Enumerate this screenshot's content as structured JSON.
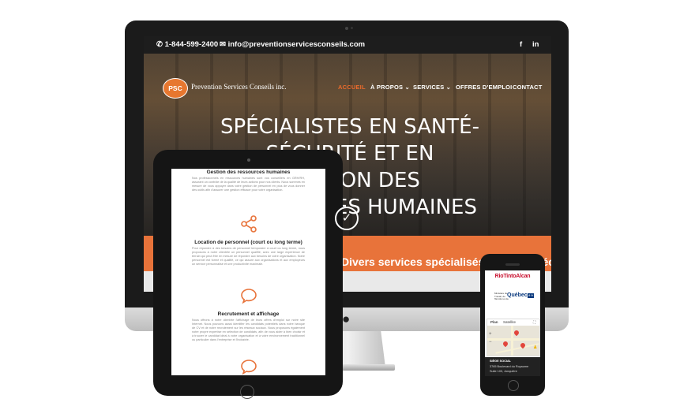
{
  "desktop": {
    "topbar": {
      "phone": "1-844-599-2400",
      "email": "info@preventionservicesconseils.com",
      "social": [
        "f",
        "in"
      ]
    },
    "logo": {
      "badge": "PSC",
      "text": "Prevention Services Conseils inc."
    },
    "nav": [
      {
        "label": "ACCUEIL",
        "active": true
      },
      {
        "label": "À PROPOS ⌄",
        "active": false
      },
      {
        "label": "SERVICES ⌄",
        "active": false
      },
      {
        "label": "OFFRES D'EMPLOI",
        "active": false
      },
      {
        "label": "CONTACT",
        "active": false
      }
    ],
    "hero_title": "SPÉCIALISTES EN SANTÉ-SÉCURITÉ ET EN GESTION DES RESSOURCES HUMAINES",
    "check_glyph": "✓",
    "band_text": "Divers services spécialisés en santé-sécurité",
    "colors": {
      "accent": "#e8733a",
      "topbar": "#1d1d1d"
    }
  },
  "tablet": {
    "sections": [
      {
        "icon": "people-icon",
        "heading": "Gestion des ressources humaines",
        "text": "Nos professionnels en ressources humaines sont vos conseillers en GRH/RH, assurant un contrôle de la qualité de leurs actions pour nos clients. Nous sommes en mesure de vous appuyer dans votre gestion de personnel en plus de vous donner des outils afin d'assurer une gestion efficace pour votre organisation."
      },
      {
        "icon": "share-icon",
        "heading": "Location de personnel (court ou long terme)",
        "text": "Pour répondre à des besoins de personnel temporaire à court ou long terme, nous proposons à notre clientèle un personnel qualifié, avec une large expérience de terrain qui peut être en mesure de répondre aux besoins de votre organisation. Notre personnel est formé et qualifié, ce qui assure aux organisations et aux employeurs un service personnalisé et une productivité maximale."
      },
      {
        "icon": "chat-bubble-icon",
        "heading": "Recrutement et affichage",
        "text": "Nous offrons à notre clientèle l'affichage de leurs offres d'emploi sur notre site Internet. Nous pouvons aussi identifier les candidats potentiels dans notre banque de CV et de notre recrutement sur les réseaux sociaux. Nous proposons également notre propre expertise en sélection de candidats, afin de vous aider à bien choisir et à trouver le candidat idéal à votre organisation et à votre environnement traditionnel ou particulier dans l'entreprise et l'industrie."
      }
    ],
    "partial_icon": "chat-bubble-icon",
    "colors": {
      "icon": "#e8733a"
    }
  },
  "phone": {
    "brand_logo": "RioTintoAlcan",
    "qc_small_text": "Ministère du Travail, de l'Emploi et de la Solidarité sociale",
    "qc_logo": "Québec",
    "qc_flag": "⚜⚜",
    "map_tabs": [
      "Plan",
      "Satellite"
    ],
    "map_zoom": [
      "+",
      "−"
    ],
    "footer_title": "SIÈGE SOCIAL",
    "footer_lines": [
      "3765 Boulevard du Royaume",
      "Suite 103, Jonquière"
    ]
  }
}
